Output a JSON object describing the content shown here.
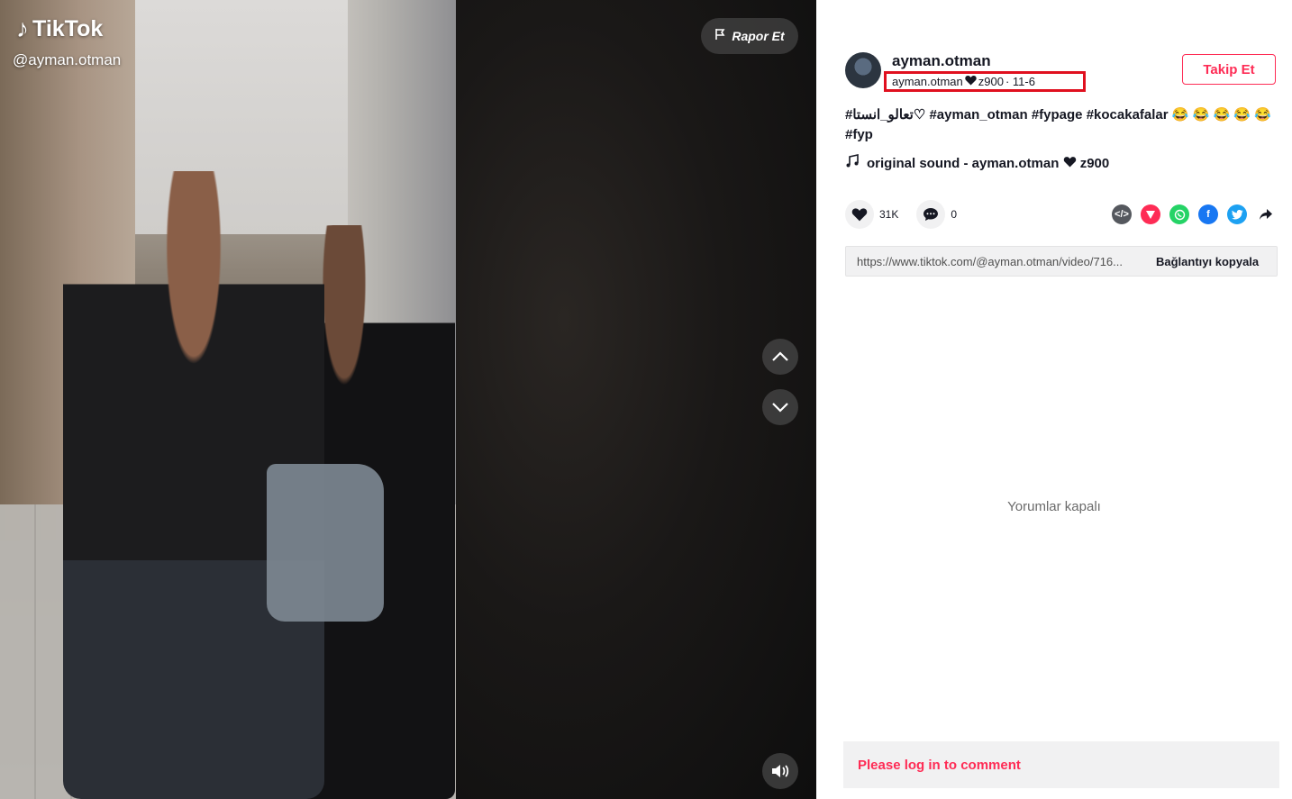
{
  "video": {
    "brand": "TikTok",
    "handle": "@ayman.otman",
    "report_label": "Rapor Et"
  },
  "author": {
    "username": "ayman.otman",
    "nickname_prefix": "ayman.otman",
    "nickname_suffix": "z900",
    "date_text": " · 11-6",
    "follow_label": "Takip Et"
  },
  "description": {
    "tags_line1": [
      "#تعالو_انستا♡",
      "#ayman_otman",
      "#fypage",
      "#kocakafalar"
    ],
    "emojis": "😂 😂 😂 😂 😂",
    "tags_line2": [
      "#fyp"
    ]
  },
  "sound": {
    "prefix": "original sound - ayman.otman",
    "suffix": "z900"
  },
  "stats": {
    "likes": "31K",
    "comments": "0"
  },
  "share_icons": [
    "embed-icon",
    "send-icon",
    "whatsapp-icon",
    "facebook-icon",
    "twitter-icon",
    "share-arrow-icon"
  ],
  "link": {
    "url": "https://www.tiktok.com/@ayman.otman/video/716...",
    "copy_label": "Bağlantıyı kopyala"
  },
  "comments_status": "Yorumlar kapalı",
  "login_prompt": "Please log in to comment",
  "colors": {
    "brand_red": "#fe2c55",
    "highlight_box": "#e0101f"
  }
}
